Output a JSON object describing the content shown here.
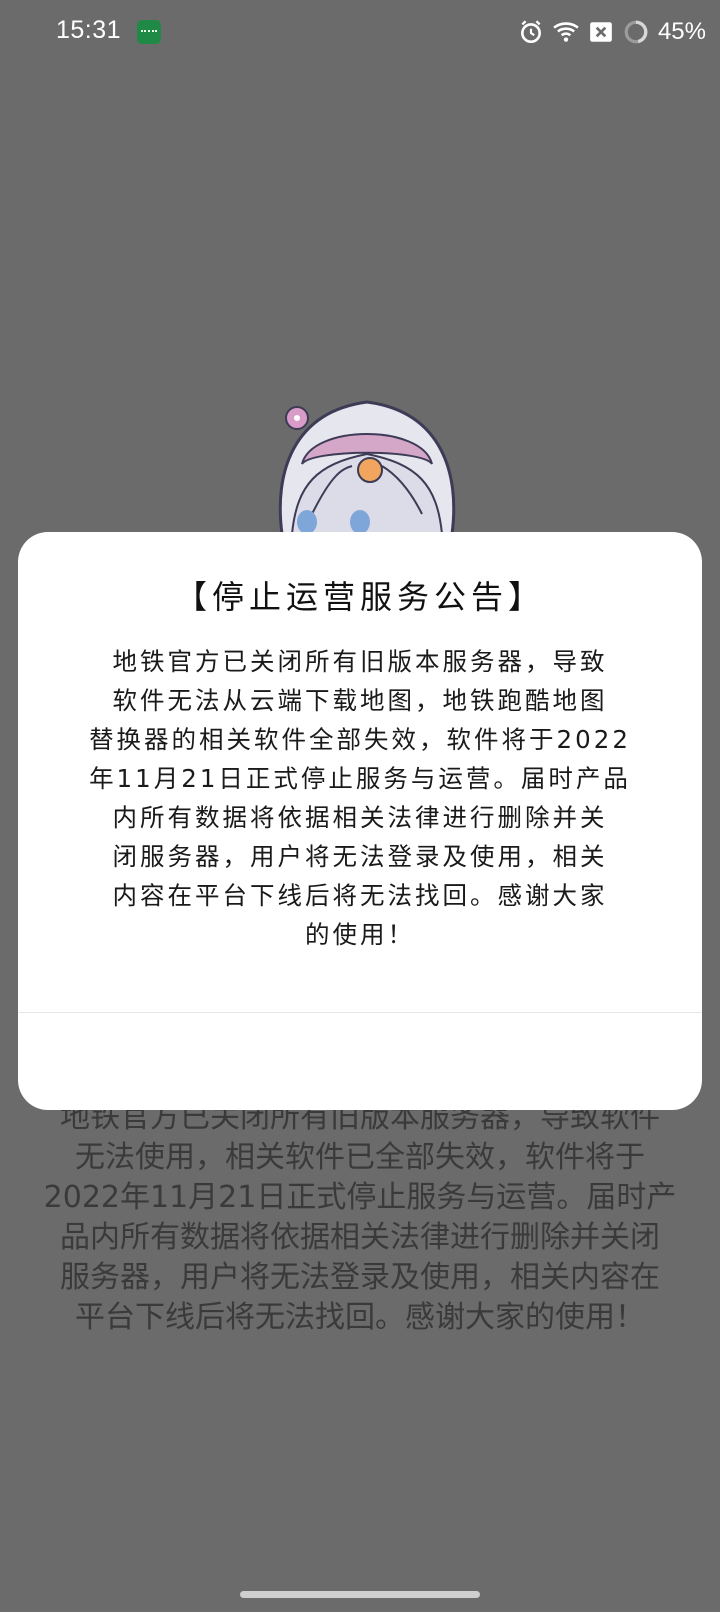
{
  "status_bar": {
    "time": "15:31",
    "app_icon": "app-notification-icon",
    "icons": [
      "alarm-icon",
      "wifi-icon",
      "no-sim-icon",
      "battery-icon"
    ],
    "battery": "45%"
  },
  "background": {
    "mascot_icon": "anime-mascot-image",
    "text_lines": [
      "地铁官方已关闭所有旧版本服务器，导致软件",
      "无法使用，相关软件已全部失效，软件将于",
      "2022年11月21日正式停止服务与运营。届时产",
      "品内所有数据将依据相关法律进行删除并关闭",
      "服务器，用户将无法登录及使用，相关内容在",
      "平台下线后将无法找回。感谢大家的使用！"
    ]
  },
  "dialog": {
    "title": "【停止运营服务公告】",
    "body_lines": [
      "地铁官方已关闭所有旧版本服务器，导致",
      "软件无法从云端下载地图，地铁跑酷地图",
      "替换器的相关软件全部失效，软件将于2022",
      "年11月21日正式停止服务与运营。届时产品",
      "内所有数据将依据相关法律进行删除并关",
      "闭服务器，用户将无法登录及使用，相关",
      "内容在平台下线后将无法找回。感谢大家",
      "的使用！"
    ]
  },
  "colors": {
    "overlay": "#6b6b6b",
    "dialog_bg": "#ffffff",
    "text": "#1a1a1a"
  }
}
